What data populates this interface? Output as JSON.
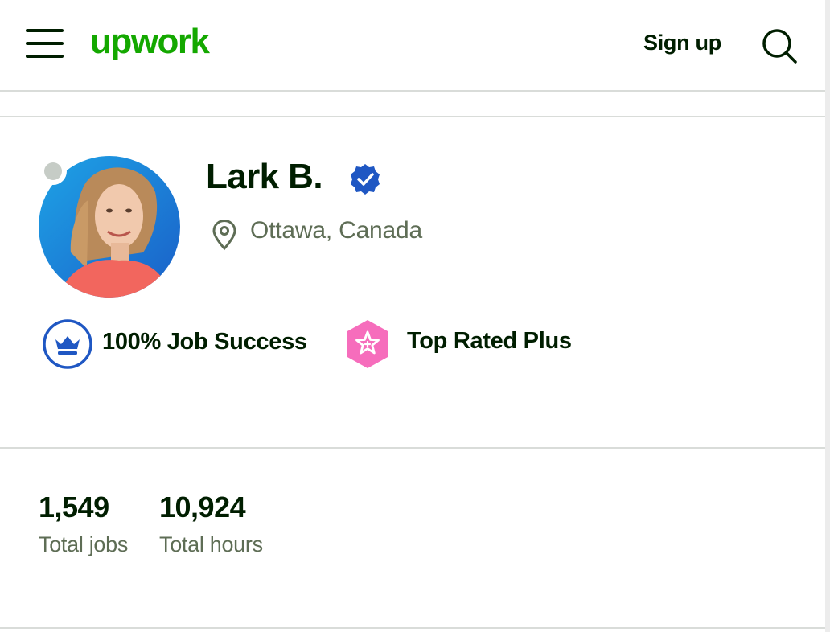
{
  "header": {
    "logo_text": "upwork",
    "signup_label": "Sign up"
  },
  "profile": {
    "name": "Lark B.",
    "location": "Ottawa, Canada",
    "badges": [
      {
        "label": "100% Job Success",
        "icon": "crown-icon"
      },
      {
        "label": "Top Rated Plus",
        "icon": "star-hexagon-icon"
      }
    ]
  },
  "stats": [
    {
      "value": "1,549",
      "label": "Total jobs"
    },
    {
      "value": "10,924",
      "label": "Total hours"
    }
  ],
  "colors": {
    "brand_green": "#14a800",
    "text_dark": "#001e00",
    "text_muted": "#5e6d55",
    "verified_blue": "#1f57c3",
    "top_rated_plus_pink": "#f66dbc",
    "divider": "#d9dcd9"
  }
}
